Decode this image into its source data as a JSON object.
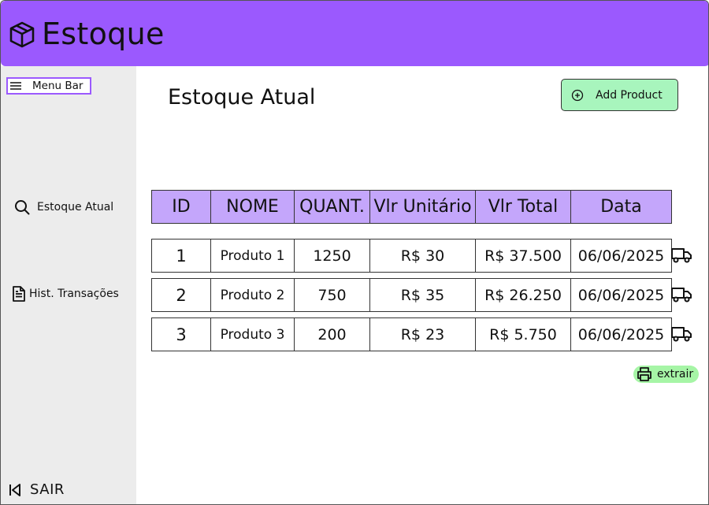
{
  "header": {
    "title": "Estoque",
    "logo_icon": "package-icon",
    "bg_color": "#9b59fe"
  },
  "sidebar": {
    "menu_bar_label": "Menu Bar",
    "items": [
      {
        "label": "Estoque Atual",
        "icon": "search-icon"
      },
      {
        "label": "Hist. Transações",
        "icon": "document-icon"
      }
    ],
    "logout_label": "SAIR"
  },
  "main": {
    "title": "Estoque Atual",
    "add_button_label": "Add Product",
    "table": {
      "headers": [
        "ID",
        "NOME",
        "QUANT.",
        "Vlr Unitário",
        "Vlr Total",
        "Data"
      ],
      "rows": [
        [
          "1",
          "Produto 1",
          "1250",
          "R$ 30",
          "R$ 37.500",
          "06/06/2025"
        ],
        [
          "2",
          "Produto 2",
          "750",
          "R$ 35",
          "R$ 26.250",
          "06/06/2025"
        ],
        [
          "3",
          "Produto 3",
          "200",
          "R$ 23",
          "R$ 5.750",
          "06/06/2025"
        ]
      ],
      "row_action_icon": "truck-icon"
    },
    "export_button_label": "extrair",
    "colors": {
      "header_row": "#c4a6fb",
      "add_button": "#a8f5bd",
      "export_button": "#a6f5a6"
    }
  }
}
